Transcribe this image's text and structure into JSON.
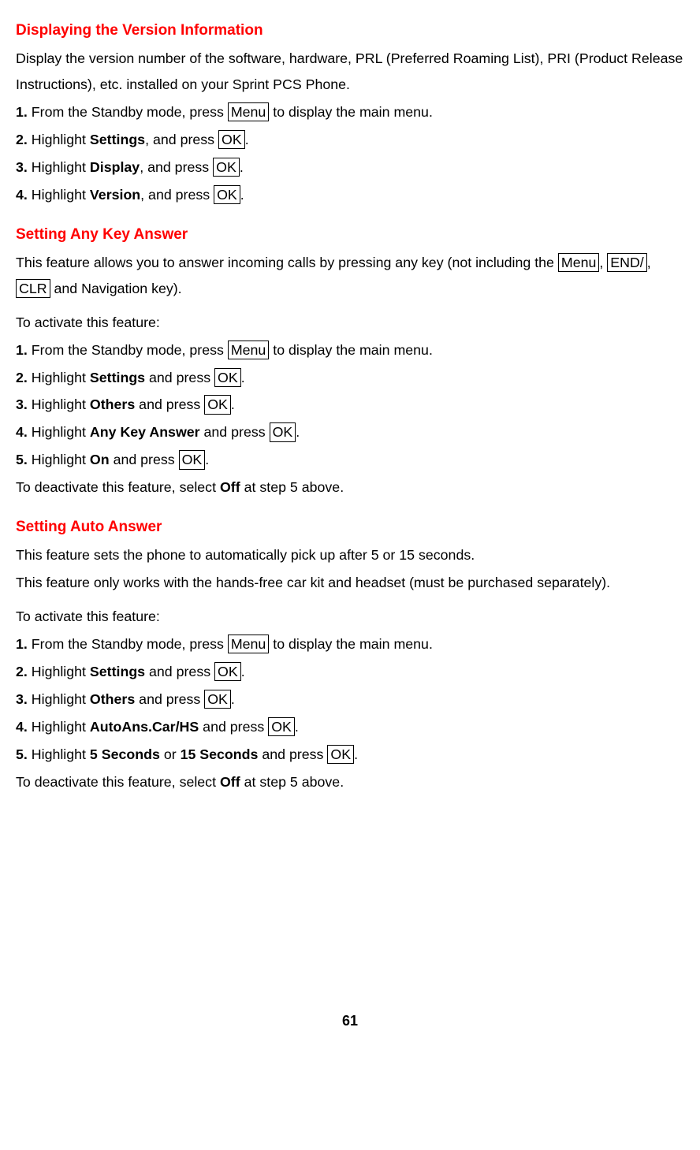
{
  "section1": {
    "heading": "Displaying the Version Information",
    "intro": "Display the version number of the software, hardware, PRL (Preferred Roaming List), PRI (Product Release Instructions), etc. installed on your Sprint PCS Phone.",
    "steps": {
      "s1_num": "1.",
      "s1_a": " From the Standby mode, press ",
      "s1_key": "Menu",
      "s1_b": " to display the main menu.",
      "s2_num": "2.",
      "s2_a": " Highlight ",
      "s2_bold": "Settings",
      "s2_b": ", and press ",
      "s2_key": "OK",
      "s2_c": ".",
      "s3_num": "3.",
      "s3_a": " Highlight ",
      "s3_bold": "Display",
      "s3_b": ", and press ",
      "s3_key": "OK",
      "s3_c": ".",
      "s4_num": "4.",
      "s4_a": " Highlight ",
      "s4_bold": "Version",
      "s4_b": ", and press ",
      "s4_key": "OK",
      "s4_c": "."
    }
  },
  "section2": {
    "heading": "Setting Any Key Answer",
    "intro_a": "This feature allows you to answer incoming calls by pressing any key (not including the ",
    "intro_key1": "Menu",
    "intro_b": ", ",
    "intro_key2": "END/",
    "intro_c": ", ",
    "intro_key3": "CLR",
    "intro_d": " and Navigation key).",
    "activate": "To activate this feature:",
    "steps": {
      "s1_num": "1.",
      "s1_a": " From the Standby mode, press ",
      "s1_key": "Menu",
      "s1_b": " to display the main menu.",
      "s2_num": "2.",
      "s2_a": " Highlight ",
      "s2_bold": "Settings",
      "s2_b": " and press ",
      "s2_key": "OK",
      "s2_c": ".",
      "s3_num": "3.",
      "s3_a": " Highlight ",
      "s3_bold": "Others",
      "s3_b": " and press ",
      "s3_key": "OK",
      "s3_c": ".",
      "s4_num": "4.",
      "s4_a": " Highlight ",
      "s4_bold": "Any Key Answer",
      "s4_b": " and press ",
      "s4_key": "OK",
      "s4_c": ".",
      "s5_num": "5.",
      "s5_a": " Highlight ",
      "s5_bold": "On",
      "s5_b": " and press ",
      "s5_key": "OK",
      "s5_c": "."
    },
    "deactivate_a": "To deactivate this feature, select ",
    "deactivate_bold": "Off",
    "deactivate_b": " at step 5 above."
  },
  "section3": {
    "heading": "Setting Auto Answer",
    "intro1": "This feature sets the phone to automatically pick up after 5 or 15 seconds.",
    "intro2": "This feature only works with the hands-free car kit and headset (must be purchased separately).",
    "activate": "To activate this feature:",
    "steps": {
      "s1_num": "1.",
      "s1_a": " From the Standby mode, press ",
      "s1_key": "Menu",
      "s1_b": " to display the main menu.",
      "s2_num": "2.",
      "s2_a": " Highlight ",
      "s2_bold": "Settings",
      "s2_b": " and press ",
      "s2_key": "OK",
      "s2_c": ".",
      "s3_num": "3.",
      "s3_a": " Highlight ",
      "s3_bold": "Others",
      "s3_b": " and press ",
      "s3_key": "OK",
      "s3_c": ".",
      "s4_num": "4.",
      "s4_a": " Highlight ",
      "s4_bold": "AutoAns.Car/HS",
      "s4_b": " and press ",
      "s4_key": "OK",
      "s4_c": ".",
      "s5_num": "5.",
      "s5_a": " Highlight ",
      "s5_bold1": "5 Seconds",
      "s5_b": " or ",
      "s5_bold2": "15 Seconds",
      "s5_c": " and press ",
      "s5_key": "OK",
      "s5_d": "."
    },
    "deactivate_a": "To deactivate this feature, select ",
    "deactivate_bold": "Off",
    "deactivate_b": " at step 5 above."
  },
  "page_number": "61"
}
